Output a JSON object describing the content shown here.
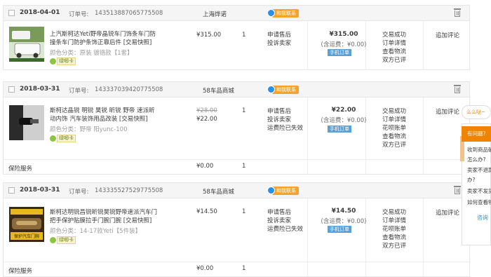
{
  "orders": [
    {
      "date": "2018-04-01",
      "order_label": "订单号:",
      "order_no": "143513887065775508",
      "shop": "上海烨诺",
      "contact": "和我联系",
      "product_name": "上汽斯柯达Yeti野帝晶锐车门饰条车门防撞条车门防护条饰正靠后件 [交易快照]",
      "product_attr": "颜色分类：原装 镀铬款【1套】",
      "badge": "绿唧卡",
      "price": "¥315.00",
      "qty": "1",
      "service": [
        "申请售后",
        "投诉卖家"
      ],
      "total": "¥315.00",
      "shipping": "(含运费：¥0.00)",
      "mobile": "手机订单",
      "status": [
        "交易成功",
        "订单详情",
        "查看物流",
        "双方已评"
      ],
      "action": "追加评论"
    },
    {
      "date": "2018-03-31",
      "order_label": "订单号:",
      "order_no": "143337039420775508",
      "shop": "58车品商城",
      "contact": "和我联系",
      "product_name": "斯柯达晶锐 明锐 昊锐 昕锐 野帝 速派昕动内饰 汽车装饰用品改装 [交易快照]",
      "product_attr": "颜色分类：野帝 阳yunc-100",
      "badge": "绿唧卡",
      "old_price": "¥28.00",
      "price": "¥22.00",
      "qty": "1",
      "service": [
        "申请售后",
        "投诉卖家",
        "运费险已失效"
      ],
      "total": "¥22.00",
      "shipping": "(含运费：¥0.00)",
      "mobile": "手机订单",
      "status": [
        "交易成功",
        "订单详情",
        "花呗账单",
        "查看物流",
        "双方已评"
      ],
      "action": "追加评论",
      "sub_label": "保险服务",
      "sub_price": "¥0.00",
      "sub_qty": "1"
    },
    {
      "date": "2018-03-31",
      "order_label": "订单号:",
      "order_no": "143335527529775508",
      "shop": "58车品商城",
      "contact": "和我联系",
      "product_name": "斯柯达明锐昌锐昕锐昊锐野帝速派汽车门把手保护贴膜拉手门腕门腕 [交易快照]",
      "product_attr": "颜色分类：14-17款Yeti【5件装】",
      "badge": "绿唧卡",
      "thumb_text": "保护汽车门腕",
      "price": "¥14.50",
      "qty": "1",
      "service": [
        "申请售后",
        "投诉卖家",
        "运费险已失效"
      ],
      "total": "¥14.50",
      "shipping": "(含运费：¥0.00)",
      "mobile": "手机订单",
      "status": [
        "交易成功",
        "订单详情",
        "花呗账单",
        "查看物流",
        "双方已评"
      ],
      "action": "追加评论",
      "sub_label": "保险服务",
      "sub_price": "¥0.00",
      "sub_qty": "1"
    }
  ],
  "side_panel": {
    "bubble": "么么哒~",
    "header": "有问题?",
    "items": [
      "收到商品破",
      "怎么办?",
      "卖家不退款",
      "办?",
      "卖家不发货",
      "如何查看物"
    ],
    "link": "咨询"
  },
  "colors": {
    "accent_orange": "#f08300",
    "contact_orange": "#f7a32a",
    "mobile_blue": "#5aa0d8",
    "header_bg": "#f5f5f5"
  }
}
